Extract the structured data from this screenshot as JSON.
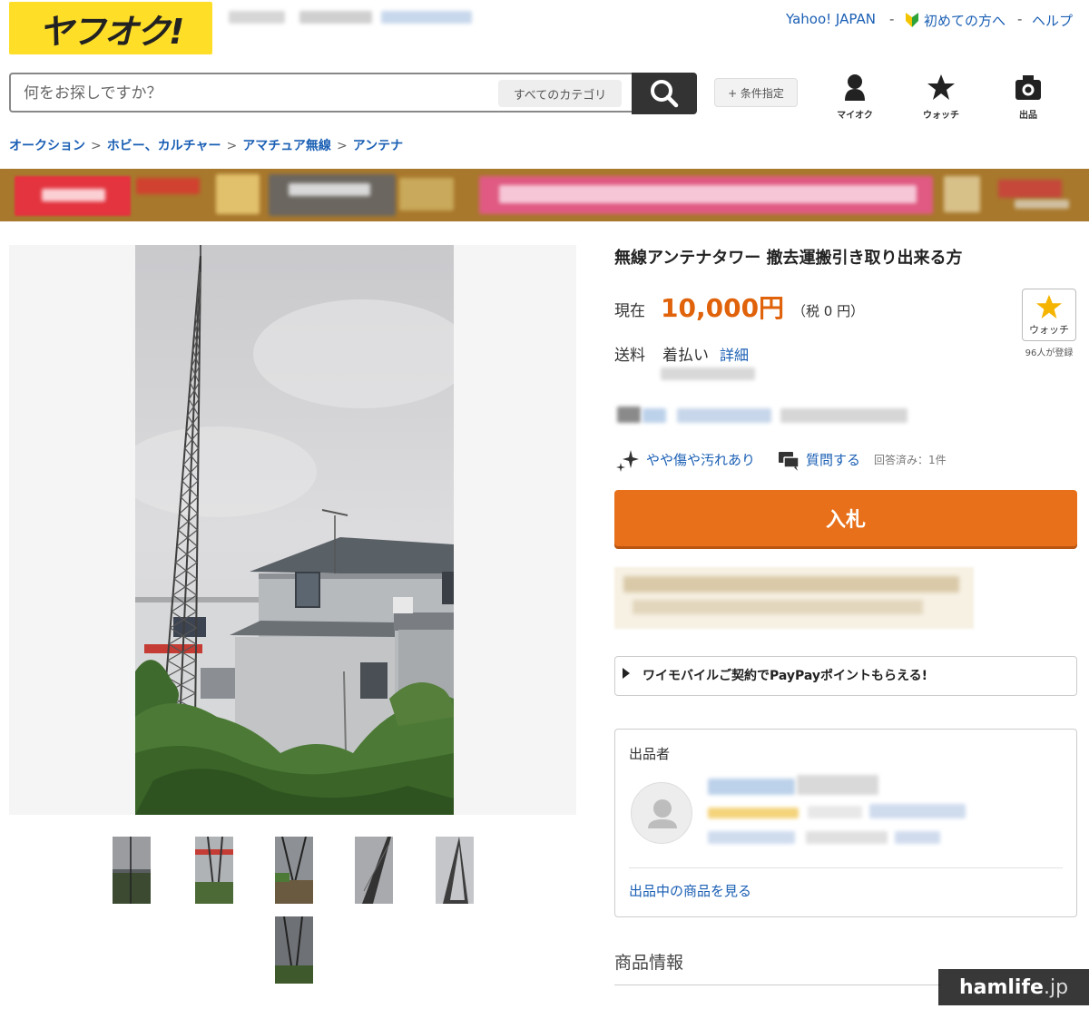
{
  "header": {
    "logo_text": "ヤフオク!",
    "links": {
      "yahoo_japan": "Yahoo! JAPAN",
      "beginners": "初めての方へ",
      "help": "ヘルプ"
    },
    "separator": "-"
  },
  "search": {
    "placeholder": "何をお探しですか？",
    "category": "すべてのカテゴリ",
    "condition_button": "+ 条件指定"
  },
  "nav": {
    "my_auction": "マイオク",
    "watch": "ウォッチ",
    "sell": "出品"
  },
  "breadcrumb": [
    "オークション",
    "ホビー、カルチャー",
    "アマチュア無線",
    "アンテナ"
  ],
  "breadcrumb_sep": ">",
  "item": {
    "title": "無線アンテナタワー 撤去運搬引き取り出来る方",
    "price_label": "現在",
    "price": "10,000円",
    "tax": "（税 0 円）",
    "shipping_label": "送料",
    "shipping_value": "着払い",
    "shipping_detail": "詳細",
    "condition": "やや傷や汚れあり",
    "question_link": "質問する",
    "answered": "回答済み：1件",
    "bid_button": "入札",
    "watch_button": "ウォッチ",
    "watch_count": "96人が登録",
    "promo_text": "ワイモバイルご契約でPayPayポイントもらえる!"
  },
  "seller": {
    "heading": "出品者",
    "link": "出品中の商品を見る"
  },
  "product_info_heading": "商品情報",
  "watermark": {
    "main": "hamlife",
    "sub": ".jp"
  },
  "colors": {
    "logo_yellow": "#ffde28",
    "price_orange": "#e0620a",
    "bid_orange": "#e8701a",
    "link_blue": "#1a5fb4"
  }
}
